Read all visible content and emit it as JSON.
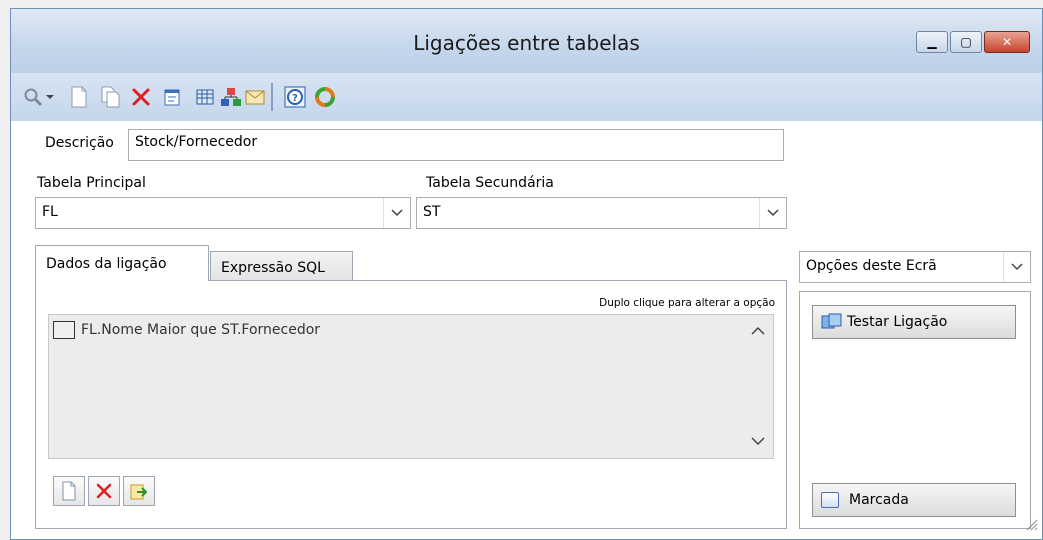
{
  "window": {
    "title": "Ligações entre tabelas",
    "buttons": {
      "minimize": "▁",
      "maximize": "▢",
      "close": "✕"
    }
  },
  "toolbar": {
    "icons": [
      "search-icon",
      "dropdown-icon",
      "new-document-icon",
      "copy-icon",
      "delete-icon",
      "properties-icon",
      "table-icon",
      "relation-icon",
      "mail-icon",
      "help-icon",
      "refresh-icon"
    ]
  },
  "form": {
    "descricao_label": "Descrição",
    "descricao_value": "Stock/Fornecedor",
    "tabela_principal_label": "Tabela Principal",
    "tabela_principal_value": "FL",
    "tabela_secundaria_label": "Tabela Secundária",
    "tabela_secundaria_value": "ST"
  },
  "tabs": [
    {
      "label": "Dados da ligação"
    },
    {
      "label": "Expressão SQL"
    }
  ],
  "ligacao": {
    "hint": "Duplo clique para alterar a opção",
    "items": [
      {
        "text": "FL.Nome Maior que  ST.Fornecedor"
      }
    ],
    "scroll_up": "⌃",
    "scroll_down": "⌄"
  },
  "opcoes": {
    "label": "Opções deste Ecrã",
    "testar_label": "Testar Ligação",
    "marcada_label": "Marcada"
  },
  "colors": {
    "delete": "#e02020",
    "accent": "#1e5fb0"
  }
}
